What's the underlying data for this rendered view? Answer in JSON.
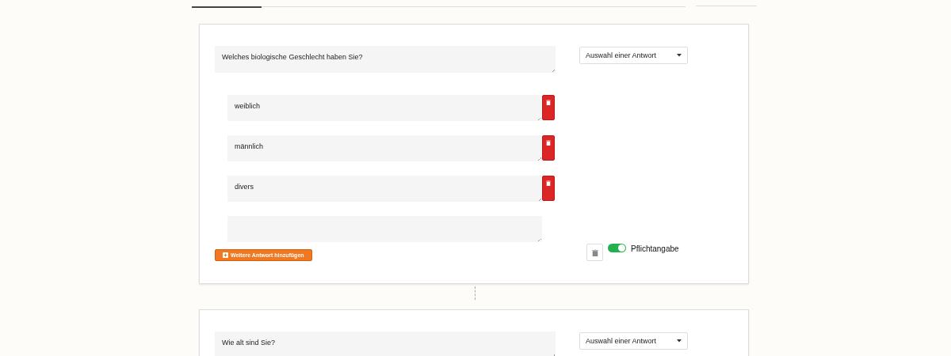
{
  "questions": [
    {
      "question": "Welches biologische Geschlecht haben Sie?",
      "type": "Auswahl einer Antwort",
      "answers": [
        {
          "kind": "filled",
          "text": "weiblich"
        },
        {
          "kind": "filled",
          "text": "männlich"
        },
        {
          "kind": "filled",
          "text": "divers"
        },
        {
          "kind": "blank"
        }
      ],
      "add_button": "Weitere Antwort hinzufügen",
      "required": true,
      "required_label": "Pflichtangabe"
    },
    {
      "question": "Wie alt sind Sie?",
      "type": "Auswahl einer Antwort"
    }
  ]
}
